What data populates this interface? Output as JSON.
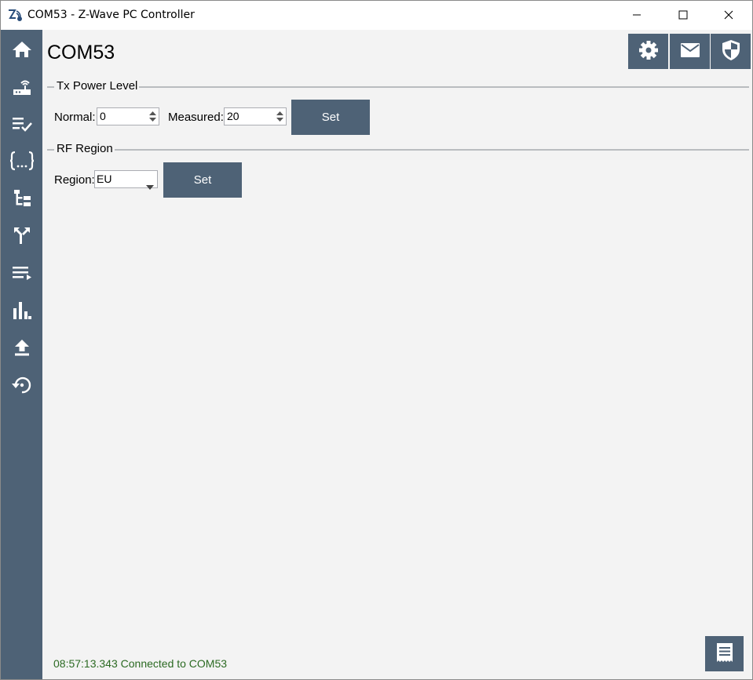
{
  "window": {
    "title": "COM53 - Z-Wave PC Controller",
    "app_icon": "zwave-logo-icon",
    "controls": [
      "minimize-icon",
      "maximize-icon",
      "close-icon"
    ]
  },
  "sidebar": {
    "items": [
      {
        "icon": "home-icon"
      },
      {
        "icon": "router-icon"
      },
      {
        "icon": "checklist-icon"
      },
      {
        "icon": "braces-icon"
      },
      {
        "icon": "tree-icon"
      },
      {
        "icon": "route-icon"
      },
      {
        "icon": "playlist-icon"
      },
      {
        "icon": "bar-chart-icon"
      },
      {
        "icon": "upload-icon"
      },
      {
        "icon": "restore-icon"
      }
    ],
    "background": "#4e6276"
  },
  "page": {
    "title": "COM53",
    "toolbar": [
      "gear-icon",
      "mail-icon",
      "shield-icon"
    ]
  },
  "tx_power": {
    "group_label": "Tx Power Level",
    "normal_label": "Normal:",
    "normal_value": "0",
    "measured_label": "Measured:",
    "measured_value": "20",
    "set_label": "Set"
  },
  "rf_region": {
    "group_label": "RF Region",
    "region_label": "Region:",
    "region_value": "EU",
    "set_label": "Set"
  },
  "status": {
    "text": "08:57:13.343 Connected to COM53",
    "color": "#2b6a22"
  },
  "log_button": {
    "icon": "log-icon"
  }
}
